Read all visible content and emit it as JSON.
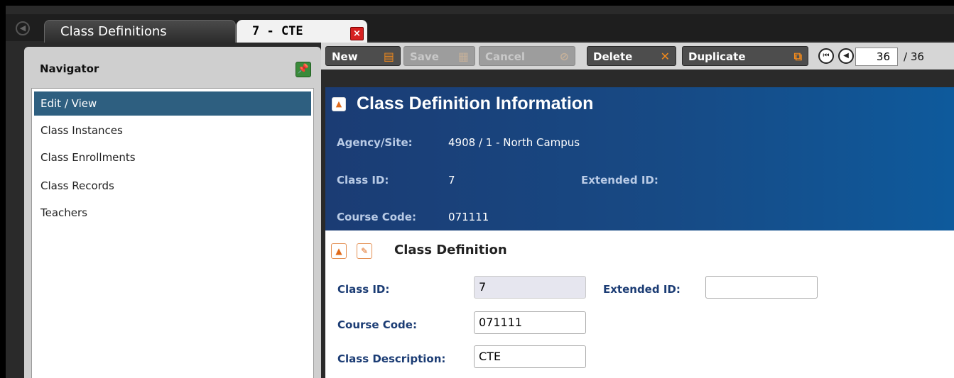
{
  "tabs": {
    "inactive_label": "Class Definitions",
    "active_label": "7 - CTE",
    "close_symbol": "×"
  },
  "navigator": {
    "title": "Navigator",
    "items": [
      {
        "label": "Edit / View",
        "selected": true
      },
      {
        "label": "Class Instances"
      },
      {
        "label": "Class Enrollments"
      },
      {
        "label": "Class Records"
      },
      {
        "label": "Teachers"
      }
    ]
  },
  "toolbar": {
    "new_label": "New",
    "save_label": "Save",
    "cancel_label": "Cancel",
    "delete_label": "Delete",
    "duplicate_label": "Duplicate",
    "current_record": "36",
    "total_records": "/ 36"
  },
  "banner": {
    "title": "Class Definition Information",
    "agency_label": "Agency/Site:",
    "agency_value": "4908 / 1 - North Campus",
    "class_id_label": "Class ID:",
    "class_id_value": "7",
    "extended_id_label": "Extended ID:",
    "course_code_label": "Course Code:",
    "course_code_value": "071111"
  },
  "form": {
    "section_title": "Class Definition",
    "class_id_label": "Class ID:",
    "class_id_value": "7",
    "extended_id_label": "Extended ID:",
    "extended_id_value": "",
    "course_code_label": "Course Code:",
    "course_code_value": "071111",
    "description_label": "Class Description:",
    "description_value": "CTE"
  },
  "colors": {
    "accent_orange": "#f28a1c",
    "banner_blue": "#1b3c74",
    "selected_nav": "#2e5f80"
  }
}
